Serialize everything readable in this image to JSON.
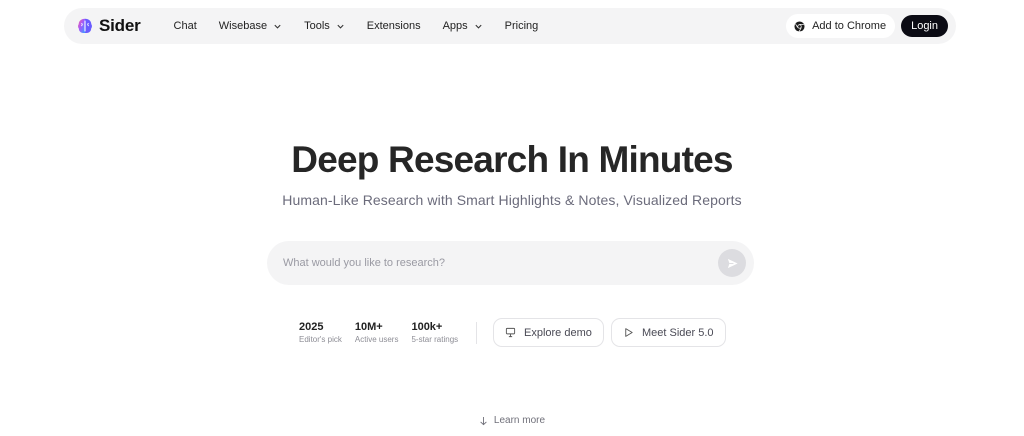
{
  "brand": {
    "name": "Sider"
  },
  "nav": {
    "items": [
      {
        "label": "Chat",
        "dropdown": false
      },
      {
        "label": "Wisebase",
        "dropdown": true
      },
      {
        "label": "Tools",
        "dropdown": true
      },
      {
        "label": "Extensions",
        "dropdown": false
      },
      {
        "label": "Apps",
        "dropdown": true
      },
      {
        "label": "Pricing",
        "dropdown": false
      }
    ],
    "add_to_chrome": "Add to Chrome",
    "login": "Login"
  },
  "hero": {
    "title": "Deep Research In Minutes",
    "subtitle": "Human-Like Research with Smart Highlights & Notes, Visualized Reports"
  },
  "search": {
    "placeholder": "What would you like to research?",
    "value": ""
  },
  "stats": [
    {
      "value": "2025",
      "label": "Editor's pick"
    },
    {
      "value": "10M+",
      "label": "Active users"
    },
    {
      "value": "100k+",
      "label": "5-star ratings"
    }
  ],
  "actions": {
    "explore_demo": "Explore demo",
    "meet_sider": "Meet Sider 5.0"
  },
  "learn_more": "Learn more",
  "icons": {
    "logo": "brain-logo-icon",
    "chevron": "chevron-down-icon",
    "chrome": "chrome-icon",
    "send": "send-arrow-icon",
    "demo": "presentation-icon",
    "play": "play-icon",
    "arrow_down": "arrow-down-icon"
  },
  "colors": {
    "nav_bg": "#f4f4f5",
    "login_bg": "#0b0b14",
    "title": "#262626",
    "subtitle": "#6b6b7b",
    "logo_gradient": [
      "#7b5cff",
      "#ff5fa2",
      "#3aa0ff"
    ]
  }
}
